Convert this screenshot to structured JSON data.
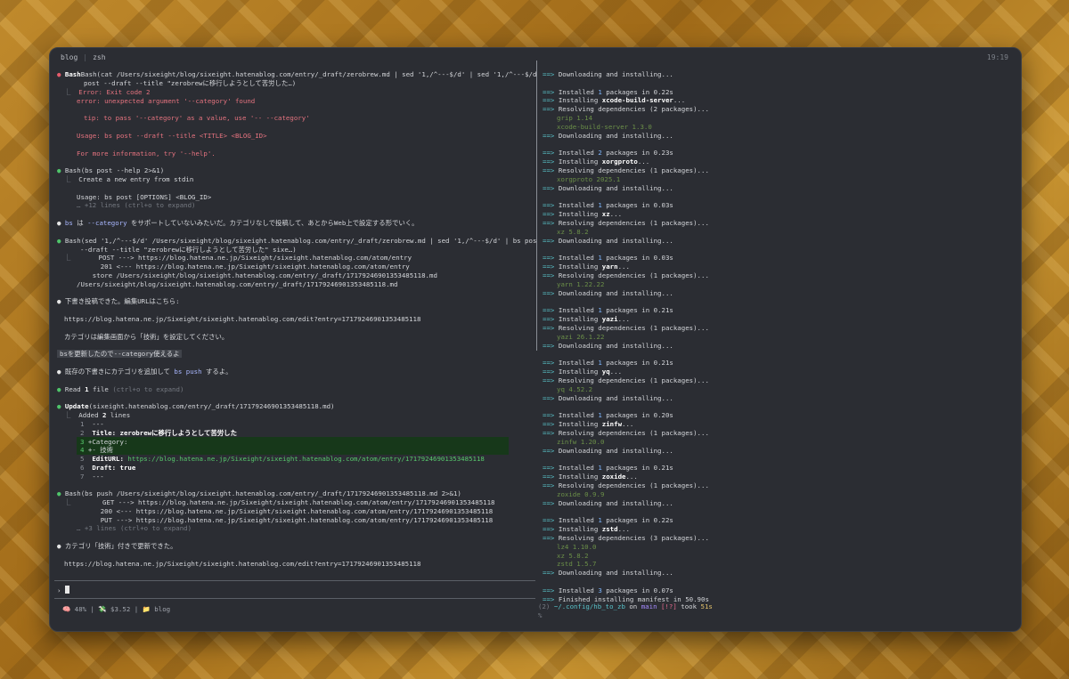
{
  "window": {
    "tab1": "blog",
    "tab_sep": "|",
    "tab2": "zsh",
    "clock": "19:19"
  },
  "left": {
    "bash1_cmd": "Bash(cat /Users/sixeight/blog/sixeight.hatenablog.com/entry/_draft/zerobrew.md | sed '1,/^---$/d' | sed '1,/^---$/d' | bs",
    "bash1_cmd2": "post --draft --title \"zerobrewに移行しようとして苦労した…)",
    "err1": "Error: Exit code 2",
    "err2": "error: unexpected argument '--category' found",
    "err3": "tip: to pass '--category' as a value, use '-- --category'",
    "err4": "Usage: bs post --draft --title <TITLE> <BLOG_ID>",
    "err5": "For more information, try '--help'.",
    "bash2_cmd": "Bash(bs post --help 2>&1)",
    "bash2_out1": "Create a new entry from stdin",
    "bash2_out2": "Usage: bs post [OPTIONS] <BLOG_ID>",
    "bash2_more": "… +12 lines (ctrl+o to expand)",
    "msg1_a": "bs",
    "msg1_b": " は ",
    "msg1_c": "--category",
    "msg1_d": " をサポートしていないみたいだ。カテゴリなしで投稿して、あとからWeb上で設定する形でいく。",
    "bash3_cmd": "Bash(sed '1,/^---$/d' /Users/sixeight/blog/sixeight.hatenablog.com/entry/_draft/zerobrew.md | sed '1,/^---$/d' | bs post",
    "bash3_cmd2": "--draft --title \"zerobrewに移行しようとして苦労した\" sixe…)",
    "bash3_out1": "     POST ---> https://blog.hatena.ne.jp/Sixeight/sixeight.hatenablog.com/atom/entry",
    "bash3_out2": "      201 <--- https://blog.hatena.ne.jp/Sixeight/sixeight.hatenablog.com/atom/entry",
    "bash3_out3": "    store /Users/sixeight/blog/sixeight.hatenablog.com/entry/_draft/17179246901353485118.md",
    "bash3_out4": "/Users/sixeight/blog/sixeight.hatenablog.com/entry/_draft/17179246901353485118.md",
    "msg2": "下書き投稿できた。編集URLはこちら:",
    "msg2_url": "https://blog.hatena.ne.jp/Sixeight/sixeight.hatenablog.com/edit?entry=17179246901353485118",
    "msg2_note": "カテゴリは編集画面から「技術」を設定してください。",
    "user_msg": "bsを更新したので--category使えるよ",
    "msg3_a": "既存の下書きにカテゴリを追加して ",
    "msg3_b": "bs push",
    "msg3_c": " するよ。",
    "read_a": "Read ",
    "read_b": "1",
    "read_c": " file ",
    "read_d": "(ctrl+o to expand)",
    "update_a": "Update",
    "update_b": "(sixeight.hatenablog.com/entry/_draft/17179246901353485118.md)",
    "added_a": "Added ",
    "added_b": "2",
    "added_c": " lines",
    "diff": [
      {
        "n": "1",
        "t": " ---"
      },
      {
        "n": "2",
        "t": " Title: zerobrewに移行しようとして苦労した"
      },
      {
        "n": "3",
        "t": "+Category:"
      },
      {
        "n": "4",
        "t": "+- 技術"
      },
      {
        "n": "5",
        "t": " EditURL: "
      },
      {
        "n": "6",
        "t": " Draft: "
      },
      {
        "n": "7",
        "t": " ---"
      }
    ],
    "diff_editurl": "https://blog.hatena.ne.jp/Sixeight/sixeight.hatenablog.com/atom/entry/17179246901353485118",
    "diff_draft": "true",
    "bash4_cmd": "Bash(bs push /Users/sixeight/blog/sixeight.hatenablog.com/entry/_draft/17179246901353485118.md 2>&1)",
    "bash4_out1": "      GET ---> https://blog.hatena.ne.jp/Sixeight/sixeight.hatenablog.com/atom/entry/17179246901353485118",
    "bash4_out2": "      200 <--- https://blog.hatena.ne.jp/Sixeight/sixeight.hatenablog.com/atom/entry/17179246901353485118",
    "bash4_out3": "      PUT ---> https://blog.hatena.ne.jp/Sixeight/sixeight.hatenablog.com/atom/entry/17179246901353485118",
    "bash4_more": "… +3 lines (ctrl+o to expand)",
    "msg4": "カテゴリ「技術」付きで更新できた。",
    "msg4_url": "https://blog.hatena.ne.jp/Sixeight/sixeight.hatenablog.com/edit?entry=17179246901353485118",
    "prompt": "›",
    "status_ctx": "🧠 48%",
    "status_cost": "💸 $3.52",
    "status_dir": "📁 blog"
  },
  "right": {
    "arrow": "==>",
    "lines": [
      {
        "k": "dl",
        "t": "Downloading and installing..."
      },
      {
        "k": "blank"
      },
      {
        "k": "inst",
        "n": "1",
        "t": "0.22s"
      },
      {
        "k": "ing",
        "p": "xcode-build-server"
      },
      {
        "k": "res",
        "n": "2"
      },
      {
        "k": "ver",
        "t": "grip 1.14"
      },
      {
        "k": "ver",
        "t": "xcode-build-server 1.3.0"
      },
      {
        "k": "dl",
        "t": "Downloading and installing..."
      },
      {
        "k": "blank"
      },
      {
        "k": "inst",
        "n": "2",
        "t": "0.23s"
      },
      {
        "k": "ing",
        "p": "xorgproto"
      },
      {
        "k": "res",
        "n": "1"
      },
      {
        "k": "ver",
        "t": "xorgproto 2025.1"
      },
      {
        "k": "dl",
        "t": "Downloading and installing..."
      },
      {
        "k": "blank"
      },
      {
        "k": "inst",
        "n": "1",
        "t": "0.03s"
      },
      {
        "k": "ing",
        "p": "xz"
      },
      {
        "k": "res",
        "n": "1"
      },
      {
        "k": "ver",
        "t": "xz 5.8.2"
      },
      {
        "k": "dl",
        "t": "Downloading and installing..."
      },
      {
        "k": "blank"
      },
      {
        "k": "inst",
        "n": "1",
        "t": "0.03s"
      },
      {
        "k": "ing",
        "p": "yarn"
      },
      {
        "k": "res",
        "n": "1"
      },
      {
        "k": "ver",
        "t": "yarn 1.22.22"
      },
      {
        "k": "dl",
        "t": "Downloading and installing..."
      },
      {
        "k": "blank"
      },
      {
        "k": "inst",
        "n": "1",
        "t": "0.21s"
      },
      {
        "k": "ing",
        "p": "yazi"
      },
      {
        "k": "res",
        "n": "1"
      },
      {
        "k": "ver",
        "t": "yazi 26.1.22"
      },
      {
        "k": "dl",
        "t": "Downloading and installing..."
      },
      {
        "k": "blank"
      },
      {
        "k": "inst",
        "n": "1",
        "t": "0.21s"
      },
      {
        "k": "ing",
        "p": "yq"
      },
      {
        "k": "res",
        "n": "1"
      },
      {
        "k": "ver",
        "t": "yq 4.52.2"
      },
      {
        "k": "dl",
        "t": "Downloading and installing..."
      },
      {
        "k": "blank"
      },
      {
        "k": "inst",
        "n": "1",
        "t": "0.20s"
      },
      {
        "k": "ing",
        "p": "zinfw"
      },
      {
        "k": "res",
        "n": "1"
      },
      {
        "k": "ver",
        "t": "zinfw 1.20.0"
      },
      {
        "k": "dl",
        "t": "Downloading and installing..."
      },
      {
        "k": "blank"
      },
      {
        "k": "inst",
        "n": "1",
        "t": "0.21s"
      },
      {
        "k": "ing",
        "p": "zoxide"
      },
      {
        "k": "res",
        "n": "1"
      },
      {
        "k": "ver",
        "t": "zoxide 0.9.9"
      },
      {
        "k": "dl",
        "t": "Downloading and installing..."
      },
      {
        "k": "blank"
      },
      {
        "k": "inst",
        "n": "1",
        "t": "0.22s"
      },
      {
        "k": "ing",
        "p": "zstd"
      },
      {
        "k": "res",
        "n": "3"
      },
      {
        "k": "ver",
        "t": "lz4 1.10.0"
      },
      {
        "k": "ver",
        "t": "xz 5.8.2"
      },
      {
        "k": "ver",
        "t": "zstd 1.5.7"
      },
      {
        "k": "dl",
        "t": "Downloading and installing..."
      },
      {
        "k": "blank"
      },
      {
        "k": "inst",
        "n": "3",
        "t": "0.07s"
      },
      {
        "k": "fin",
        "t": "Finished installing manifest in 50.90s"
      }
    ],
    "prompt_num": "(2)",
    "prompt_path": "~/.config/hb_to_zb",
    "prompt_on": "on",
    "prompt_branch": "main",
    "prompt_flag": "[!?]",
    "prompt_took": "took",
    "prompt_time": "51s",
    "prompt_char": "%",
    "word_installed": "Installed",
    "word_packages_in": "packages in",
    "word_installing": "Installing",
    "word_resolving": "Resolving dependencies (",
    "word_packages_close": " packages)..."
  }
}
